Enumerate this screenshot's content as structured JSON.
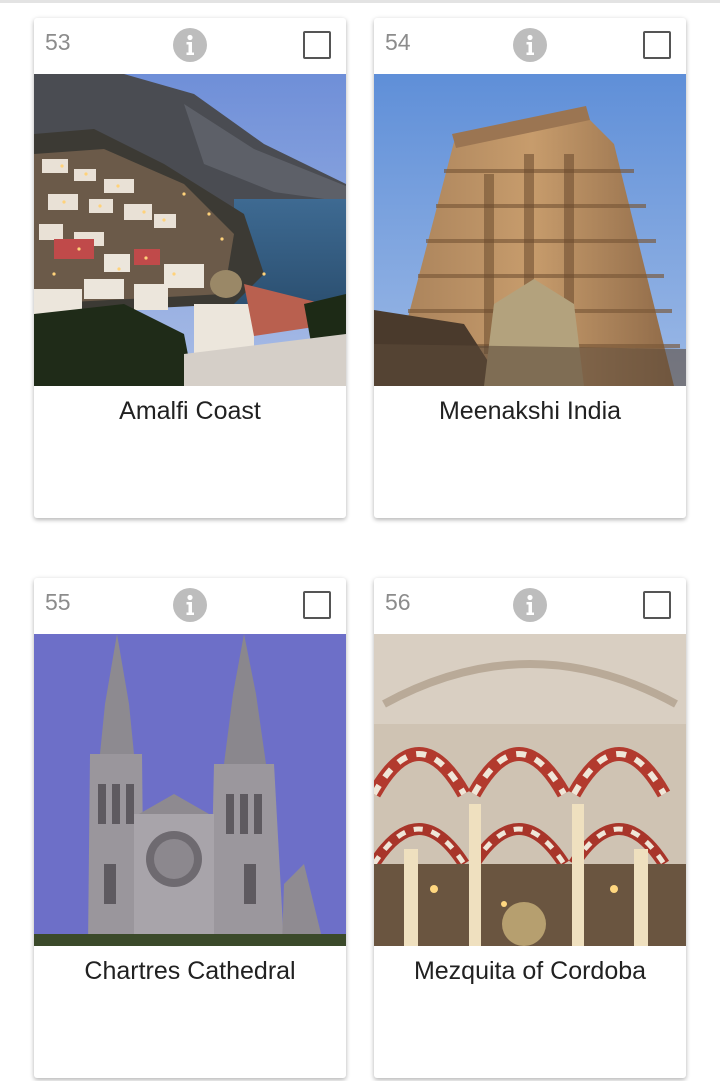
{
  "cards": [
    {
      "number": "53",
      "title": "Amalfi Coast",
      "image": "amalfi-coast-photo"
    },
    {
      "number": "54",
      "title": "Meenakshi India",
      "image": "meenakshi-temple-photo"
    },
    {
      "number": "55",
      "title": "Chartres Cathedral",
      "image": "chartres-cathedral-photo"
    },
    {
      "number": "56",
      "title": "Mezquita of Cordoba",
      "image": "mezquita-cordoba-photo"
    }
  ],
  "icons": {
    "info": "info-icon",
    "checkbox": "checkbox-unchecked"
  },
  "colors": {
    "number_text": "#8c8c8c",
    "info_icon": "#bdbdbd",
    "title_text": "#212121"
  }
}
